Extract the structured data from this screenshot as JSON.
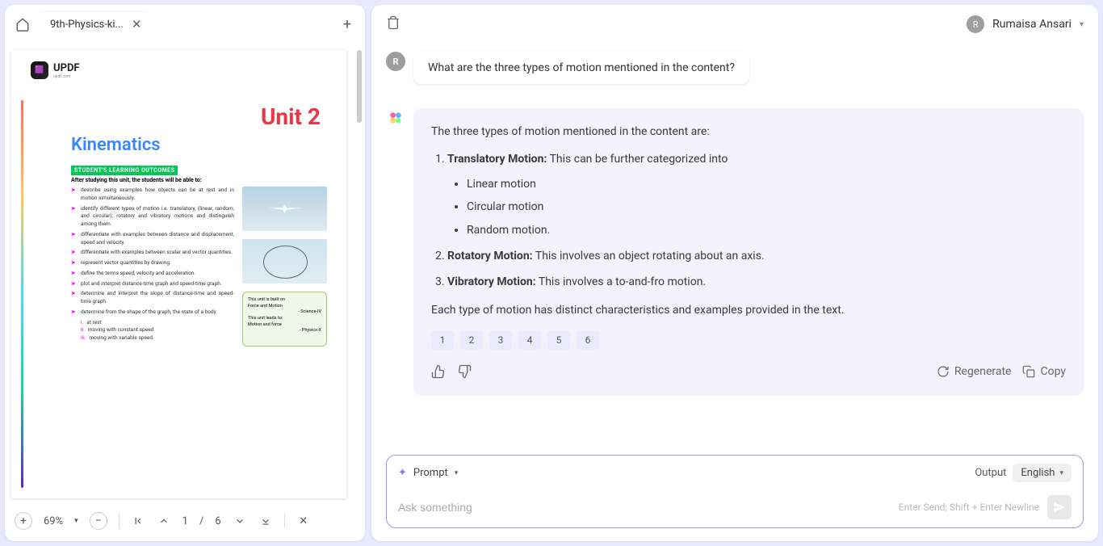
{
  "left": {
    "tab_title": "9th-Physics-ki...",
    "updf_text": "UPDF",
    "updf_sub": "updf.com",
    "page": {
      "unit": "Unit 2",
      "chapter": "Kinematics",
      "outcomes_heading": "STUDENT'S LEARNING OUTCOMES",
      "intro": "After studying this unit, the students will be able to:",
      "objectives": [
        "describe using examples how objects can be at rest and in motion simultaneously.",
        "identify different types of motion i.e. translatory, (linear, random, and circular); rotatory and vibratory motions and distinguish among them.",
        "differentiate with examples between distance and displacement, speed and velocity.",
        "differentiate with examples between scalar and vector quantities.",
        "represent vector quantities by drawing.",
        "define the terms speed, velocity and acceleration.",
        "plot and interpret distance-time graph and speed-time graph.",
        "determine and interpret the slope of distance-time and speed-time graph.",
        "determine from the shape of the graph, the state of a body"
      ],
      "sub_items": [
        "at rest",
        "moving with constant speed",
        "moving with variable speed."
      ],
      "info_box": {
        "l1": "This unit is built on",
        "l2": "Force and Motion",
        "l3": "- Science-IV",
        "l4": "This unit leads to:",
        "l5": "Motion and force",
        "l6": "- Physics-X"
      }
    },
    "zoom": "69%",
    "zoom_caret": "▾",
    "page_current": "1",
    "page_sep": "/",
    "page_total": "6"
  },
  "right": {
    "username": "Rumaisa Ansari",
    "user_initial": "R",
    "user_question": "What are the three types of motion mentioned in the content?",
    "ai_intro": "The three types of motion mentioned in the content are:",
    "motion1_title": "Translatory Motion:",
    "motion1_text": " This can be further categorized into",
    "motion1_subs": [
      "Linear motion",
      "Circular motion",
      "Random motion."
    ],
    "motion2_title": "Rotatory Motion:",
    "motion2_text": " This involves an object rotating about an axis.",
    "motion3_title": "Vibratory Motion:",
    "motion3_text": " This involves a to-and-fro motion.",
    "ai_outro": "Each type of motion has distinct characteristics and examples provided in the text.",
    "refs": [
      "1",
      "2",
      "3",
      "4",
      "5",
      "6"
    ],
    "regenerate": "Regenerate",
    "copy": "Copy",
    "prompt_label": "Prompt",
    "output_label": "Output",
    "language": "English",
    "placeholder": "Ask something",
    "hint": "Enter Send; Shift + Enter Newline"
  }
}
